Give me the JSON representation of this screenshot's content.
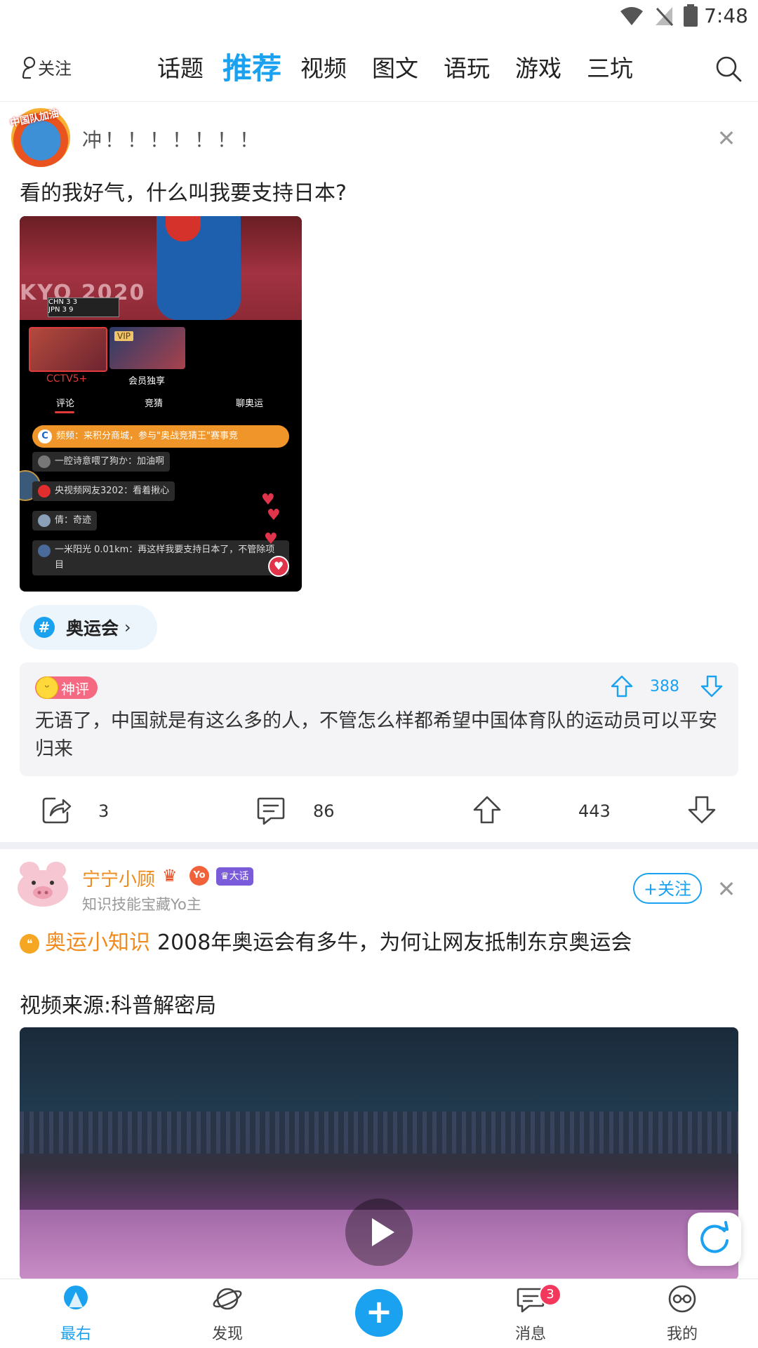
{
  "status_bar": {
    "time": "7:48"
  },
  "top_nav": {
    "follow_label": "关注",
    "tabs": [
      {
        "label": "话题"
      },
      {
        "label": "推荐"
      },
      {
        "label": "视频"
      },
      {
        "label": "图文"
      },
      {
        "label": "语玩"
      },
      {
        "label": "游戏"
      },
      {
        "label": "三坑"
      }
    ],
    "active_tab": "推荐"
  },
  "post1": {
    "avatar_text": "中国队加油",
    "username": "冲！！！！！！！",
    "text": "看的我好气，什么叫我要支持日本?",
    "image": {
      "tokyo_text": "KYO 2020",
      "score_rows": [
        "CHN 3 3",
        "JPN 3 9"
      ],
      "thumb_caption_1": "CCTV5+",
      "thumb_caption_2": "会员独享",
      "vip_label": "VIP",
      "sub_tabs": [
        "评论",
        "竞猜",
        "聊奥运"
      ],
      "banner": "频频：来积分商城，参与\"奥战竞猜王\"赛事竞",
      "comments": [
        "一腔诗意喂了狗か：加油啊",
        "央视频网友3202：看着揪心",
        "倩：奇迹",
        "一米阳光 0.01km：再这样我要支持日本了，不管除项目"
      ]
    },
    "topic": "奥运会",
    "god_comment": {
      "badge": "神评",
      "votes": "388",
      "text": "无语了，中国就是有这么多的人，不管怎么样都希望中国体育队的运动员可以平安归来"
    },
    "actions": {
      "share": "3",
      "comments": "86",
      "likes": "443"
    }
  },
  "post2": {
    "username": "宁宁小顾",
    "yo_badge": "Yo",
    "dahua_badge": "大话",
    "subtitle": "知识技能宝藏Yo主",
    "follow_label": "+关注",
    "tag": "奥运小知识",
    "title": "2008年奥运会有多牛，为何让网友抵制东京奥运会",
    "source": "视频来源:科普解密局"
  },
  "bottom_nav": {
    "items": [
      {
        "label": "最右"
      },
      {
        "label": "发现"
      },
      {
        "label": "消息"
      },
      {
        "label": "我的"
      }
    ],
    "message_badge": "3",
    "publish_symbol": "+"
  },
  "colors": {
    "accent": "#1aa1f0",
    "orange": "#f08a1c",
    "badge_red": "#f4375c"
  }
}
